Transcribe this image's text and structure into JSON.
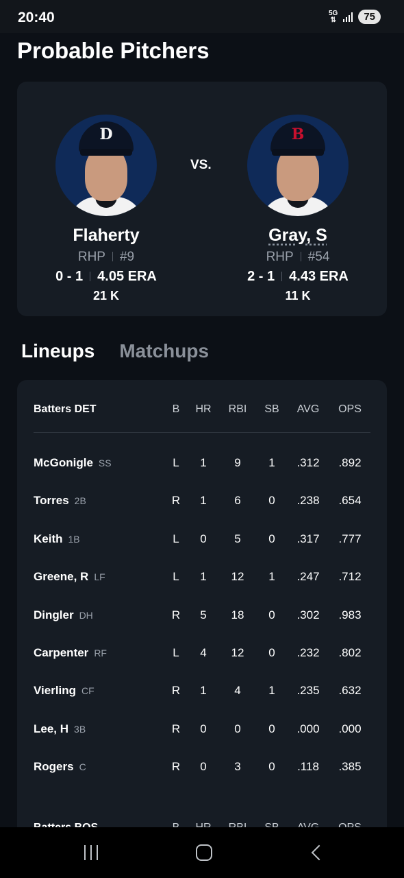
{
  "status_bar": {
    "time": "20:40",
    "network": "5G",
    "battery": "75"
  },
  "page_title": "Probable Pitchers",
  "pitchers": {
    "vs_label": "VS.",
    "away": {
      "name": "Flaherty",
      "throws": "RHP",
      "number": "#9",
      "record": "0 - 1",
      "era": "4.05 ERA",
      "strikeouts": "21 K",
      "cap_logo": "D",
      "logo_color": "#f4f4f4"
    },
    "home": {
      "name": "Gray, S",
      "throws": "RHP",
      "number": "#54",
      "record": "2 - 1",
      "era": "4.43 ERA",
      "strikeouts": "11 K",
      "cap_logo": "B",
      "logo_color": "#c8102e"
    }
  },
  "tabs": [
    {
      "label": "Lineups",
      "active": true
    },
    {
      "label": "Matchups",
      "active": false
    }
  ],
  "lineup": {
    "header": {
      "title": "Batters DET",
      "cols": [
        "B",
        "HR",
        "RBI",
        "SB",
        "AVG",
        "OPS"
      ]
    },
    "rows": [
      {
        "name": "McGonigle",
        "pos": "SS",
        "b": "L",
        "hr": "1",
        "rbi": "9",
        "sb": "1",
        "avg": ".312",
        "ops": ".892"
      },
      {
        "name": "Torres",
        "pos": "2B",
        "b": "R",
        "hr": "1",
        "rbi": "6",
        "sb": "0",
        "avg": ".238",
        "ops": ".654"
      },
      {
        "name": "Keith",
        "pos": "1B",
        "b": "L",
        "hr": "0",
        "rbi": "5",
        "sb": "0",
        "avg": ".317",
        "ops": ".777"
      },
      {
        "name": "Greene, R",
        "pos": "LF",
        "b": "L",
        "hr": "1",
        "rbi": "12",
        "sb": "1",
        "avg": ".247",
        "ops": ".712"
      },
      {
        "name": "Dingler",
        "pos": "DH",
        "b": "R",
        "hr": "5",
        "rbi": "18",
        "sb": "0",
        "avg": ".302",
        "ops": ".983"
      },
      {
        "name": "Carpenter",
        "pos": "RF",
        "b": "L",
        "hr": "4",
        "rbi": "12",
        "sb": "0",
        "avg": ".232",
        "ops": ".802"
      },
      {
        "name": "Vierling",
        "pos": "CF",
        "b": "R",
        "hr": "1",
        "rbi": "4",
        "sb": "1",
        "avg": ".235",
        "ops": ".632"
      },
      {
        "name": "Lee, H",
        "pos": "3B",
        "b": "R",
        "hr": "0",
        "rbi": "0",
        "sb": "0",
        "avg": ".000",
        "ops": ".000"
      },
      {
        "name": "Rogers",
        "pos": "C",
        "b": "R",
        "hr": "0",
        "rbi": "3",
        "sb": "0",
        "avg": ".118",
        "ops": ".385"
      }
    ],
    "next_header": {
      "title": "Batters BOS",
      "cols": [
        "B",
        "HR",
        "RBI",
        "SB",
        "AVG",
        "OPS"
      ]
    }
  },
  "nav_bar": {
    "icons": [
      "recents-icon",
      "home-icon",
      "back-icon"
    ]
  }
}
